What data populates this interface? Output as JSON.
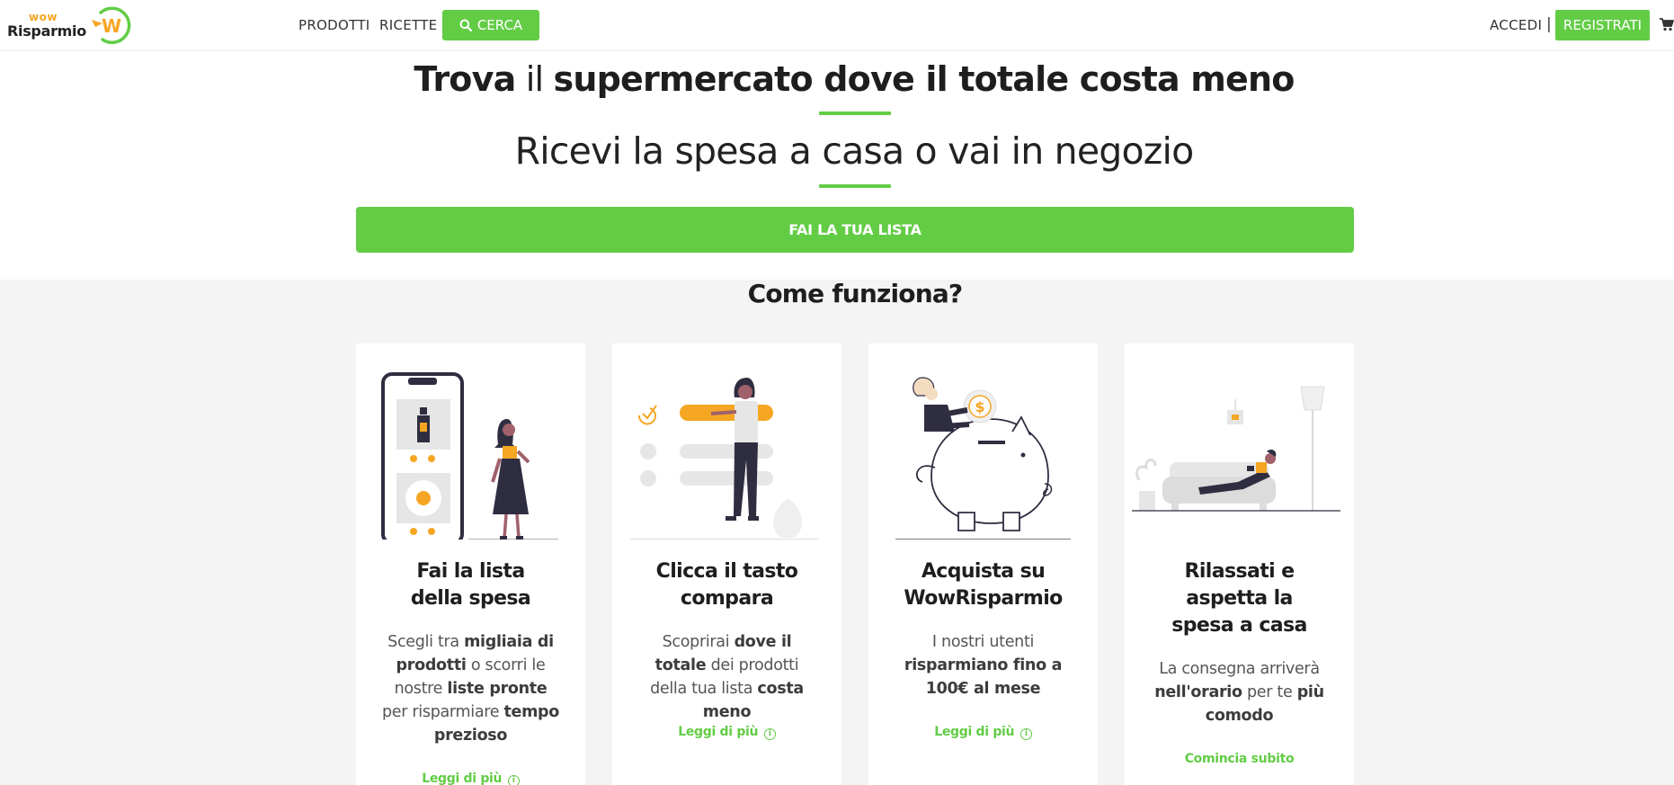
{
  "nav": {
    "logo_top": "wow",
    "logo_bottom": "Risparmio",
    "logo_mark": "W",
    "prodotti": "PRODOTTI",
    "ricette": "RICETTE",
    "cerca": "CERCA",
    "accedi": "ACCEDI",
    "separator": "|",
    "registrati": "REGISTRATI"
  },
  "hero": {
    "title_1": "Trova",
    "title_2": " il ",
    "title_3": "supermercato dove il totale costa meno",
    "subtitle": "Ricevi la spesa a casa o vai in negozio",
    "cta": "FAI LA TUA LISTA"
  },
  "how": {
    "title": "Come funziona?",
    "cards": [
      {
        "title_l1": "Fai la lista",
        "title_l2": "della spesa",
        "t1": "Scegli tra ",
        "b1": "migliaia di prodotti",
        "t2": " o scorri le nostre ",
        "b2": "liste pronte",
        "t3": " per risparmiare ",
        "b3": "tempo prezioso",
        "link": "Leggi di più"
      },
      {
        "title_l1": "Clicca il tasto",
        "title_l2": "compara",
        "t1": "Scoprirai ",
        "b1": "dove il totale",
        "t2": " dei prodotti della tua lista ",
        "b2": "costa meno",
        "link": "Leggi di più"
      },
      {
        "title_l1": "Acquista su",
        "title_l2": "WowRisparmio",
        "t1": "I nostri utenti ",
        "b1": "risparmiano fino a 100€ al mese",
        "link": "Leggi di più"
      },
      {
        "title_l1": "Rilassati e",
        "title_l2": "aspetta la",
        "title_l3": "spesa a casa",
        "t1": "La consegna arriverà ",
        "b1": "nell'orario",
        "t2": " per te ",
        "b2": "più comodo",
        "link": "Comincia subito"
      }
    ]
  },
  "colors": {
    "accent_green": "#62cc45",
    "accent_orange": "#f5a623",
    "illustration_purple": "#2f2e41",
    "background_section": "#f4f4f4"
  },
  "icons": [
    "search-icon",
    "cart-icon",
    "info-icon"
  ]
}
